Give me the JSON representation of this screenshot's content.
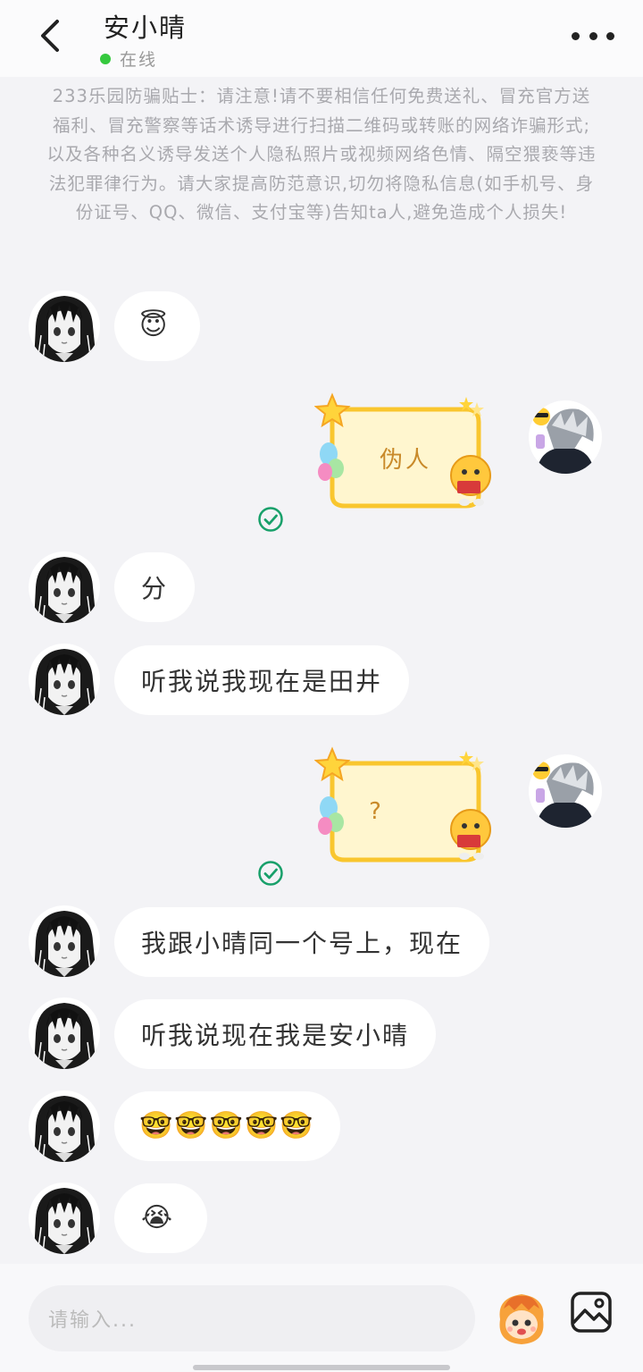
{
  "header": {
    "title": "安小晴",
    "status_text": "在线",
    "status_color": "#35c93e"
  },
  "notice": {
    "text": "233乐园防骗贴士：请注意!请不要相信任何免费送礼、冒充官方送福利、冒充警察等话术诱导进行扫描二维码或转账的网络诈骗形式;以及各种名义诱导发送个人隐私照片或视频网络色情、隔空猥亵等违法犯罪律行为。请大家提高防范意识,切勿将隐私信息(如手机号、身份证号、QQ、微信、支付宝等)告知ta人,避免造成个人损失!"
  },
  "messages": [
    {
      "side": "left",
      "type": "emoji",
      "text": "😇"
    },
    {
      "side": "right",
      "type": "card",
      "text": "伪人",
      "sent": true
    },
    {
      "side": "left",
      "type": "text",
      "text": "分"
    },
    {
      "side": "left",
      "type": "text",
      "text": "听我说我现在是田井"
    },
    {
      "side": "right",
      "type": "card",
      "text": "?",
      "sent": true
    },
    {
      "side": "left",
      "type": "text",
      "text": "我跟小晴同一个号上，现在"
    },
    {
      "side": "left",
      "type": "text",
      "text": "听我说现在我是安小晴"
    },
    {
      "side": "left",
      "type": "emoji",
      "text": "🤓🤓🤓🤓🤓"
    },
    {
      "side": "left",
      "type": "emoji",
      "text": "😭"
    }
  ],
  "input": {
    "placeholder": "请输入..."
  },
  "icons": {
    "back": "chevron-left-icon",
    "more": "more-dots-icon",
    "emoji": "emoji-face-icon",
    "image": "image-icon",
    "check": "check-circle-icon"
  }
}
